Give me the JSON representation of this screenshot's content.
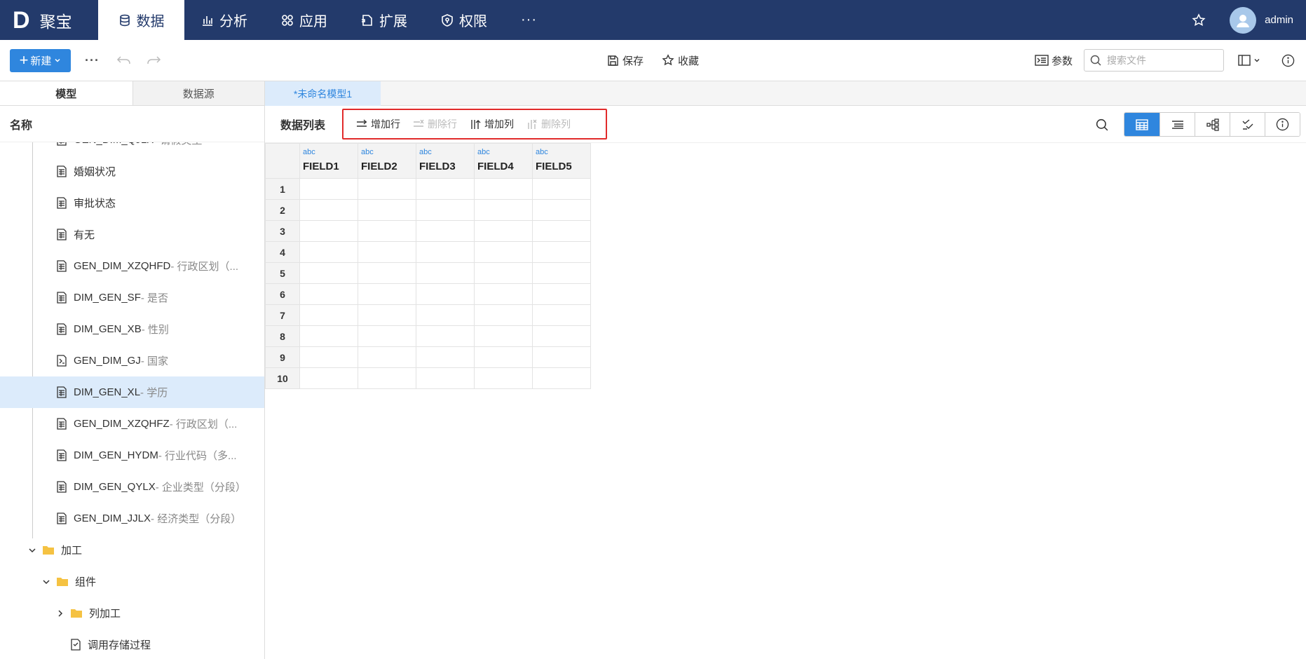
{
  "app": {
    "logo_mark": "D",
    "logo_text": "聚宝",
    "user": "admin"
  },
  "nav": [
    {
      "label": "数据",
      "icon": "database-icon"
    },
    {
      "label": "分析",
      "icon": "bar-chart-icon"
    },
    {
      "label": "应用",
      "icon": "apps-icon"
    },
    {
      "label": "扩展",
      "icon": "extension-icon"
    },
    {
      "label": "权限",
      "icon": "shield-icon"
    }
  ],
  "nav_more": "···",
  "toolbar": {
    "new_label": "新建",
    "more": "···",
    "save_label": "保存",
    "favorite_label": "收藏",
    "params_label": "参数",
    "search_placeholder": "搜索文件"
  },
  "left_tabs": [
    "模型",
    "数据源"
  ],
  "left_header": "名称",
  "tree": [
    {
      "name": "GEN_DIM_QJLX",
      "desc": " - 请假类型",
      "icon": "table-icon"
    },
    {
      "name": "婚姻状况",
      "desc": "",
      "icon": "table-icon"
    },
    {
      "name": "审批状态",
      "desc": "",
      "icon": "table-icon"
    },
    {
      "name": "有无",
      "desc": "",
      "icon": "table-icon"
    },
    {
      "name": "GEN_DIM_XZQHFD",
      "desc": " - 行政区划（...",
      "icon": "table-icon"
    },
    {
      "name": "DIM_GEN_SF",
      "desc": " - 是否",
      "icon": "table-icon"
    },
    {
      "name": "DIM_GEN_XB",
      "desc": " - 性别",
      "icon": "table-icon"
    },
    {
      "name": "GEN_DIM_GJ",
      "desc": " - 国家",
      "icon": "sql-table-icon"
    },
    {
      "name": "DIM_GEN_XL",
      "desc": " - 学历",
      "icon": "table-icon"
    },
    {
      "name": "GEN_DIM_XZQHFZ",
      "desc": " - 行政区划（...",
      "icon": "table-icon"
    },
    {
      "name": "DIM_GEN_HYDM",
      "desc": " - 行业代码（多...",
      "icon": "table-icon"
    },
    {
      "name": "DIM_GEN_QYLX",
      "desc": " - 企业类型（分段）",
      "icon": "table-icon"
    },
    {
      "name": "GEN_DIM_JJLX",
      "desc": " - 经济类型（分段）",
      "icon": "table-icon"
    }
  ],
  "folders": [
    {
      "name": "加工"
    },
    {
      "name": "组件"
    },
    {
      "name": "列加工"
    }
  ],
  "tree_last": {
    "name": "调用存储过程"
  },
  "doc_tab": "*未命名模型1",
  "data_panel": {
    "title": "数据列表",
    "actions": [
      "增加行",
      "删除行",
      "增加列",
      "删除列"
    ]
  },
  "grid": {
    "columns": [
      {
        "type": "abc",
        "name": "FIELD1"
      },
      {
        "type": "abc",
        "name": "FIELD2"
      },
      {
        "type": "abc",
        "name": "FIELD3"
      },
      {
        "type": "abc",
        "name": "FIELD4"
      },
      {
        "type": "abc",
        "name": "FIELD5"
      }
    ],
    "rows": [
      "1",
      "2",
      "3",
      "4",
      "5",
      "6",
      "7",
      "8",
      "9",
      "10"
    ]
  },
  "colors": {
    "nav_bg": "#233a6b",
    "accent": "#2f86de",
    "highlight_border": "#e12b2b",
    "selected_row": "#dcebfb"
  }
}
